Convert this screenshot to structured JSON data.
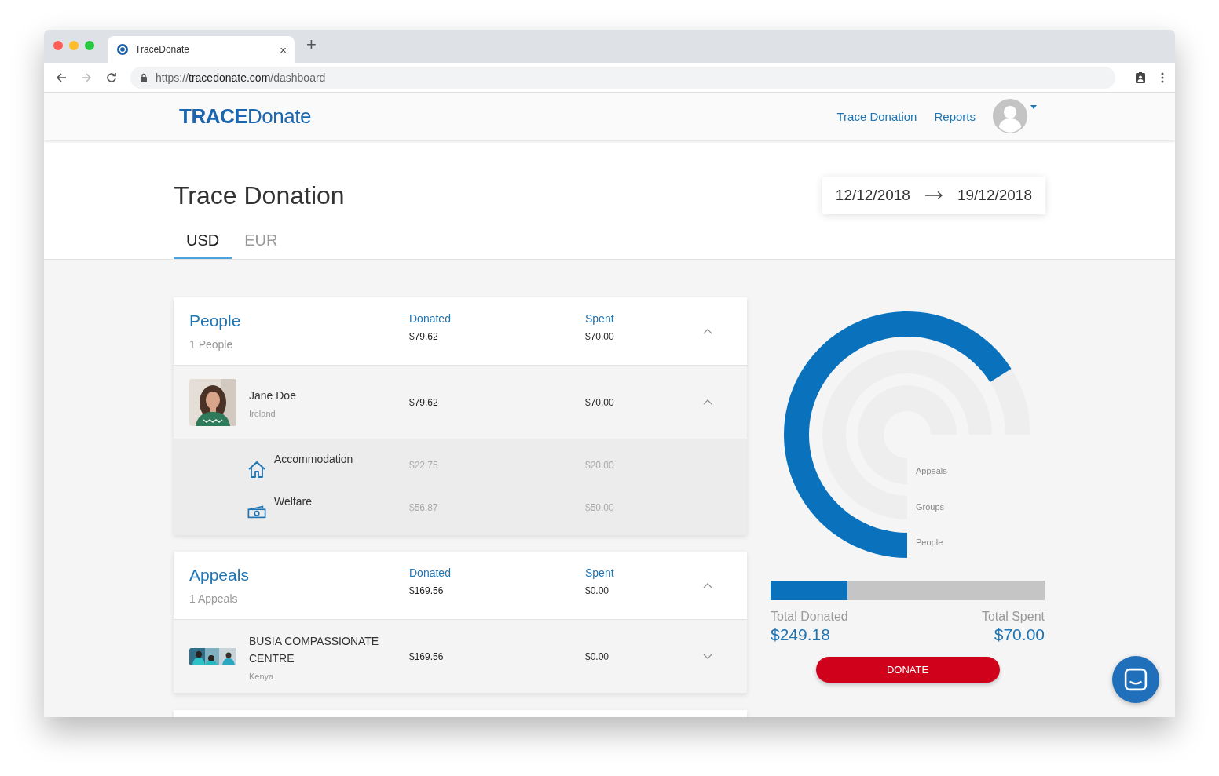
{
  "browser": {
    "tab_title": "TraceDonate",
    "close": "×",
    "new_tab": "+",
    "url": {
      "scheme": "https://",
      "host": "tracedonate.com",
      "path": "/dashboard"
    }
  },
  "header": {
    "logo": {
      "bold": "TRACE",
      "light": "Donate"
    },
    "nav": [
      {
        "label": "Trace Donation"
      },
      {
        "label": "Reports"
      }
    ]
  },
  "page": {
    "title": "Trace Donation",
    "date_from": "12/12/2018",
    "date_to": "19/12/2018",
    "tabs": [
      {
        "label": "USD",
        "selected": true
      },
      {
        "label": "EUR",
        "selected": false
      }
    ]
  },
  "sections": [
    {
      "title": "People",
      "count": "1 People",
      "donated_label": "Donated",
      "donated": "$79.62",
      "spent_label": "Spent",
      "spent": "$70.00",
      "expanded": true,
      "items": [
        {
          "kind": "person",
          "name": "Jane Doe",
          "place": "Ireland",
          "donated": "$79.62",
          "spent": "$70.00",
          "expanded": true,
          "children": [
            {
              "kind": "house",
              "name": "Accommodation",
              "donated": "$22.75",
              "spent": "$20.00"
            },
            {
              "kind": "cash",
              "name": "Welfare",
              "donated": "$56.87",
              "spent": "$50.00"
            }
          ]
        }
      ]
    },
    {
      "title": "Appeals",
      "count": "1 Appeals",
      "donated_label": "Donated",
      "donated": "$169.56",
      "spent_label": "Spent",
      "spent": "$0.00",
      "expanded": true,
      "items": [
        {
          "kind": "appeal",
          "name": "BUSIA COMPASSIONATE CENTRE",
          "place": "Kenya",
          "donated": "$169.56",
          "spent": "$0.00",
          "expanded": false
        }
      ]
    }
  ],
  "chart": {
    "rings": [
      {
        "label": "Appeals"
      },
      {
        "label": "Groups"
      },
      {
        "label": "People",
        "level": 0.88
      }
    ]
  },
  "totals": {
    "donated_label": "Total Donated",
    "donated": "$249.18",
    "spent_label": "Total Spent",
    "spent": "$70.00",
    "level": 0.28
  },
  "donate_button": "DONATE"
}
